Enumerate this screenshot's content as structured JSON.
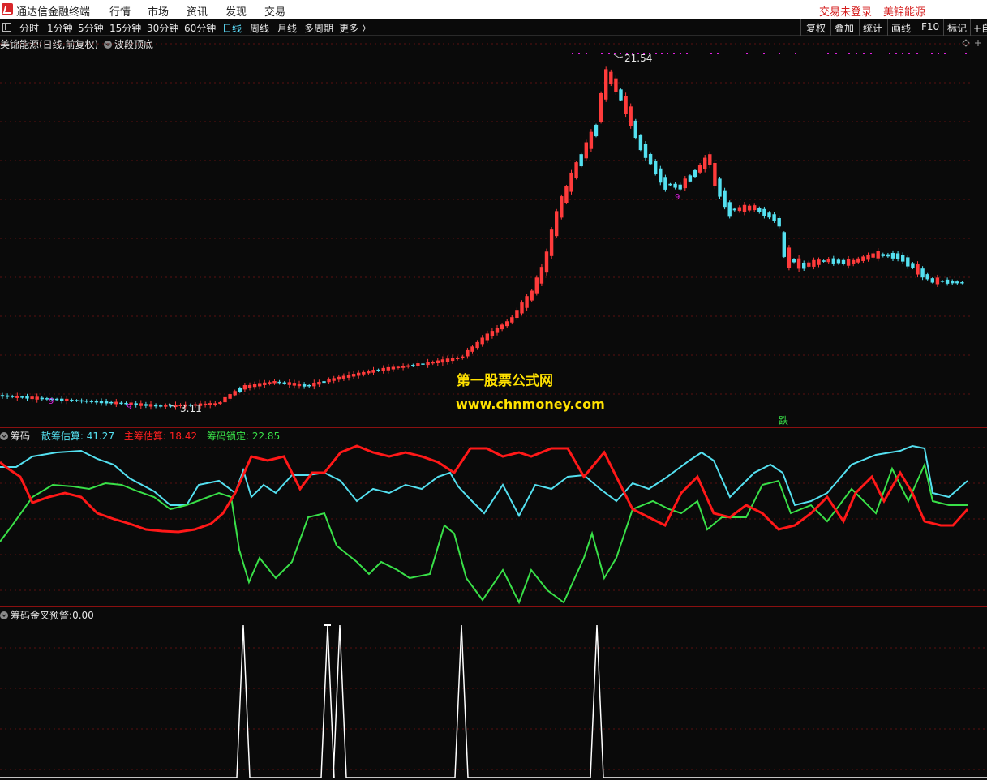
{
  "app": {
    "name": "通达信金融终端",
    "menu": [
      "行情",
      "市场",
      "资讯",
      "发现",
      "交易"
    ],
    "login_status": "交易未登录",
    "stock_name": "美锦能源"
  },
  "toolbar": {
    "periods": [
      "分时",
      "1分钟",
      "5分钟",
      "15分钟",
      "30分钟",
      "60分钟",
      "日线",
      "周线",
      "月线",
      "多周期",
      "更多 〉"
    ],
    "active_period": "日线",
    "right_buttons": [
      "复权",
      "叠加",
      "统计",
      "画线",
      "F10",
      "标记",
      "+自"
    ]
  },
  "main_chart": {
    "title": "美锦能源(日线,前复权)",
    "indicator": "波段顶底",
    "high_label": "21.54",
    "low_label": "3.11",
    "marker_digit": "9",
    "fall_label": "跌",
    "colors": {
      "up": "#ff3b3b",
      "down": "#54e0f0",
      "marker": "#e020e0"
    }
  },
  "watermark": {
    "line1": "第一股票公式网",
    "line2": "www.chnmoney.com"
  },
  "chip_panel": {
    "name": "筹码",
    "items": [
      {
        "label": "散筹估算:",
        "value": "41.27",
        "color": "#54e0f0"
      },
      {
        "label": "主筹估算:",
        "value": "18.42",
        "color": "#ff2020"
      },
      {
        "label": "筹码锁定:",
        "value": "22.85",
        "color": "#39e048"
      }
    ]
  },
  "cross_panel": {
    "name": "筹码金叉预警",
    "value": "0.00"
  }
}
